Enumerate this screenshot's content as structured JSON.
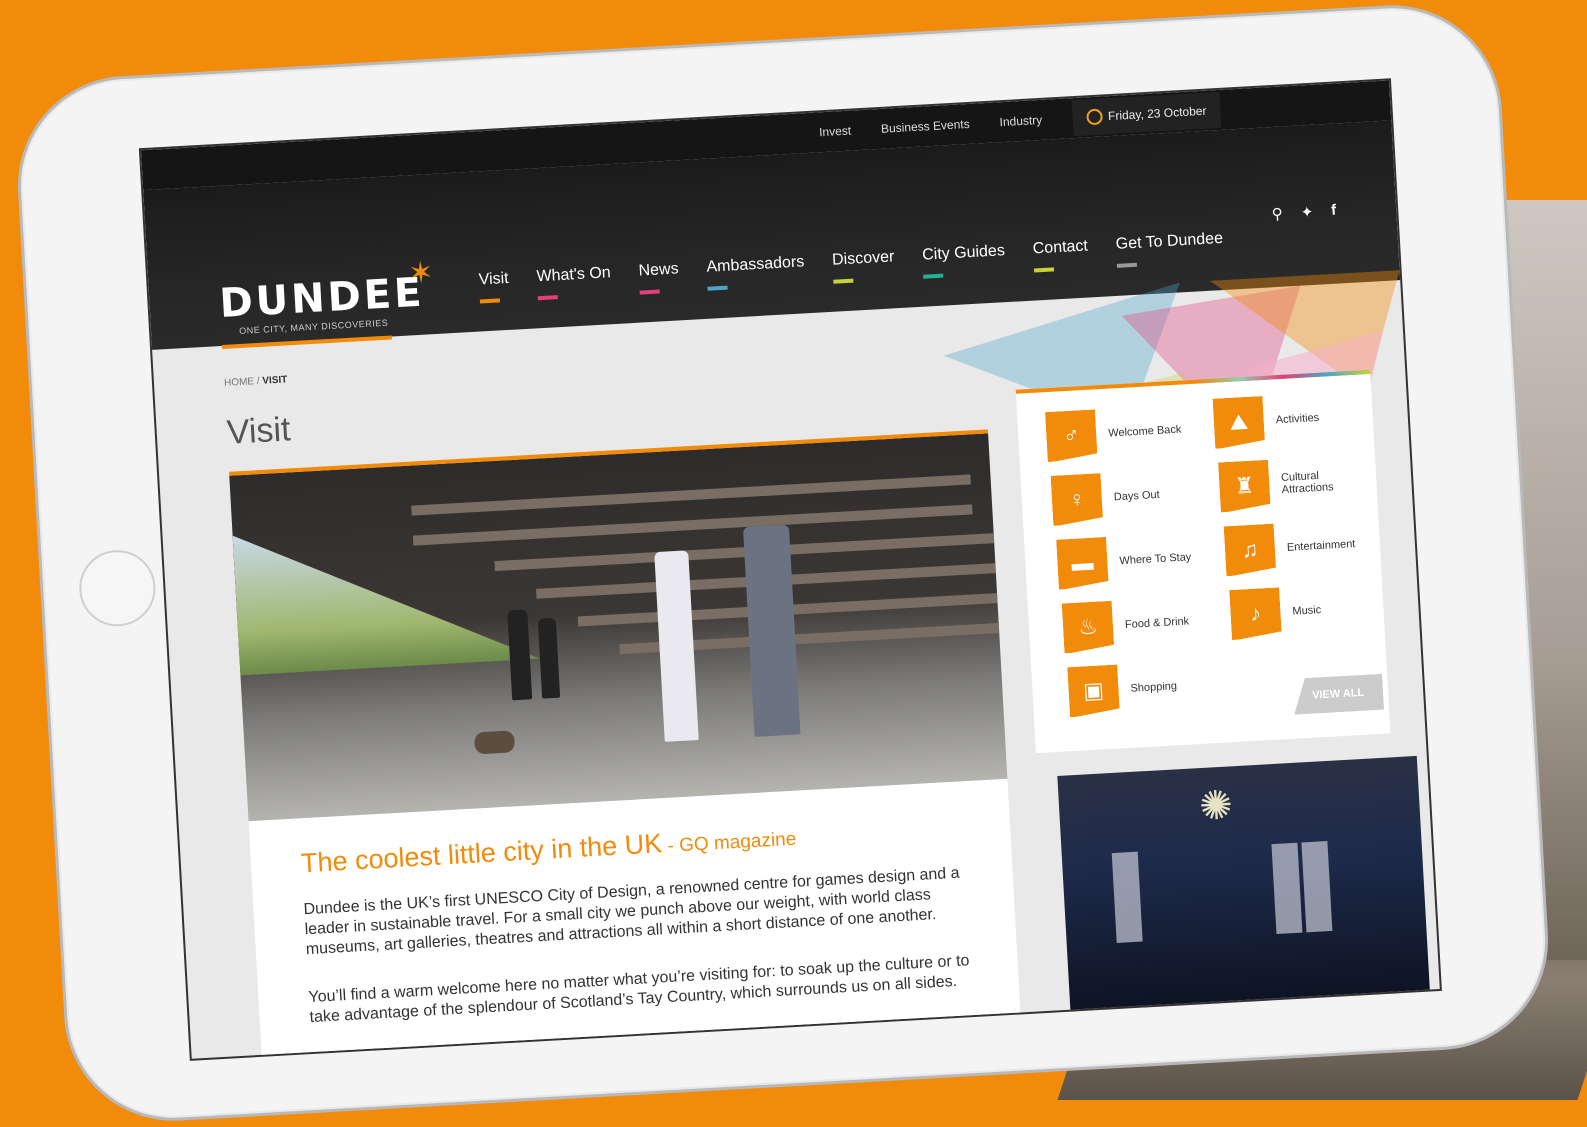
{
  "topbar": {
    "links": [
      "Invest",
      "Business Events",
      "Industry"
    ],
    "date": "Friday, 23 October"
  },
  "logo": {
    "name": "DUNDEE",
    "tagline": "ONE CITY, MANY DISCOVERIES"
  },
  "nav": {
    "items": [
      {
        "label": "Visit",
        "color": "#f28a0a"
      },
      {
        "label": "What's On",
        "color": "#e2407a"
      },
      {
        "label": "News",
        "color": "#e2407a"
      },
      {
        "label": "Ambassadors",
        "color": "#4aa6c8"
      },
      {
        "label": "Discover",
        "color": "#c5d23a"
      },
      {
        "label": "City Guides",
        "color": "#20b490"
      },
      {
        "label": "Contact",
        "color": "#c5d23a"
      },
      {
        "label": "Get To Dundee",
        "color": "#999999"
      }
    ],
    "icons": [
      "search-icon",
      "twitter-icon",
      "facebook-icon"
    ]
  },
  "breadcrumb": {
    "home": "HOME",
    "sep": " / ",
    "current": "VISIT"
  },
  "page": {
    "title": "Visit"
  },
  "article": {
    "headline": "The coolest little city in the UK",
    "source": " - GQ magazine",
    "para1": "Dundee is the UK’s first UNESCO City of Design, a renowned centre for games design and a leader in sustainable travel. For a small city we punch above our weight, with world class museums, art galleries, theatres and attractions all within a short distance of one another.",
    "para2": "You’ll find a warm welcome here no matter what you’re visiting for: to soak up the culture or to take advantage of the splendour of Scotland’s Tay Country, which surrounds us on all sides."
  },
  "categories": [
    {
      "label": "Welcome Back",
      "icon": "family-icon",
      "glyph": "♂"
    },
    {
      "label": "Activities",
      "icon": "hiker-icon",
      "glyph": "⛰"
    },
    {
      "label": "Days Out",
      "icon": "family-icon",
      "glyph": "♀"
    },
    {
      "label": "Cultural Attractions",
      "icon": "castle-icon",
      "glyph": "♜"
    },
    {
      "label": "Where To Stay",
      "icon": "bed-icon",
      "glyph": "▬"
    },
    {
      "label": "Entertainment",
      "icon": "drinks-icon",
      "glyph": "♫"
    },
    {
      "label": "Food & Drink",
      "icon": "cutlery-icon",
      "glyph": "♨"
    },
    {
      "label": "Music",
      "icon": "guitar-icon",
      "glyph": "♪"
    },
    {
      "label": "Shopping",
      "icon": "bag-icon",
      "glyph": "▣"
    }
  ],
  "view_all": "VIEW ALL",
  "colors": {
    "accent": "#f28a0a",
    "nav_bg": "#1b1b1b"
  }
}
